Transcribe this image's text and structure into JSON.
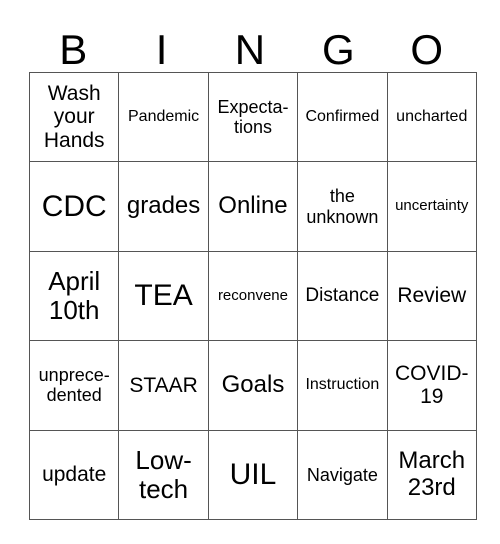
{
  "header": {
    "letters": [
      "B",
      "I",
      "N",
      "G",
      "O"
    ]
  },
  "rows": [
    [
      "Wash your Hands",
      "Pandemic",
      "Expecta- tions",
      "Confirmed",
      "uncharted"
    ],
    [
      "CDC",
      "grades",
      "Online",
      "the unknown",
      "uncertainty"
    ],
    [
      "April 10th",
      "TEA",
      "reconvene",
      "Distance",
      "Review"
    ],
    [
      "unprece- dented",
      "STAAR",
      "Goals",
      "Instruction",
      "COVID- 19"
    ],
    [
      "update",
      "Low- tech",
      "UIL",
      "Navigate",
      "March 23rd"
    ]
  ]
}
